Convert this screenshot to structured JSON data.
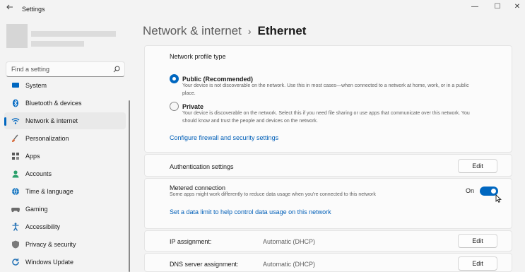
{
  "window": {
    "title": "Settings",
    "back_icon": "back-arrow-icon",
    "minimize": "—",
    "maximize": "☐",
    "close": "✕"
  },
  "search": {
    "placeholder": "Find a setting"
  },
  "nav": {
    "items": [
      {
        "label": "System",
        "icon": "system-icon",
        "color": "#0067c0"
      },
      {
        "label": "Bluetooth & devices",
        "icon": "bluetooth-icon",
        "color": "#0067c0"
      },
      {
        "label": "Network & internet",
        "icon": "wifi-icon",
        "color": "#0067c0",
        "active": true
      },
      {
        "label": "Personalization",
        "icon": "brush-icon",
        "color": "#d76a3a"
      },
      {
        "label": "Apps",
        "icon": "apps-icon",
        "color": "#5a5a5a"
      },
      {
        "label": "Accounts",
        "icon": "person-icon",
        "color": "#2aa06b"
      },
      {
        "label": "Time & language",
        "icon": "globe-clock-icon",
        "color": "#1f7ac2"
      },
      {
        "label": "Gaming",
        "icon": "controller-icon",
        "color": "#6b6b6b"
      },
      {
        "label": "Accessibility",
        "icon": "accessibility-icon",
        "color": "#1f6fb4"
      },
      {
        "label": "Privacy & security",
        "icon": "shield-icon",
        "color": "#7a7a7a"
      },
      {
        "label": "Windows Update",
        "icon": "update-icon",
        "color": "#1f6fb4"
      }
    ]
  },
  "header": {
    "parent": "Network & internet",
    "separator": "›",
    "current": "Ethernet"
  },
  "profile": {
    "heading": "Network profile type",
    "public_title": "Public (Recommended)",
    "public_desc_1": "Your device is not discoverable on the network. Use this in most cases—when connected to a network at home, work, or in a public",
    "public_desc_2": "place.",
    "private_title": "Private",
    "private_desc_1": "Your device is discoverable on the network. Select this if you need file sharing or use apps that communicate over this network. You",
    "private_desc_2": "should know and trust the people and devices on the network.",
    "selected": "public",
    "firewall_link": "Configure firewall and security settings"
  },
  "auth": {
    "label": "Authentication settings",
    "button": "Edit"
  },
  "metered": {
    "title": "Metered connection",
    "desc": "Some apps might work differently to reduce data usage when you're connected to this network",
    "state_label": "On",
    "enabled": true,
    "data_limit_link": "Set a data limit to help control data usage on this network"
  },
  "ip": {
    "label": "IP assignment:",
    "value": "Automatic (DHCP)",
    "button": "Edit"
  },
  "dns": {
    "label": "DNS server assignment:",
    "value": "Automatic (DHCP)",
    "button": "Edit"
  },
  "colors": {
    "accent": "#0067c0",
    "link": "#005fb8"
  }
}
